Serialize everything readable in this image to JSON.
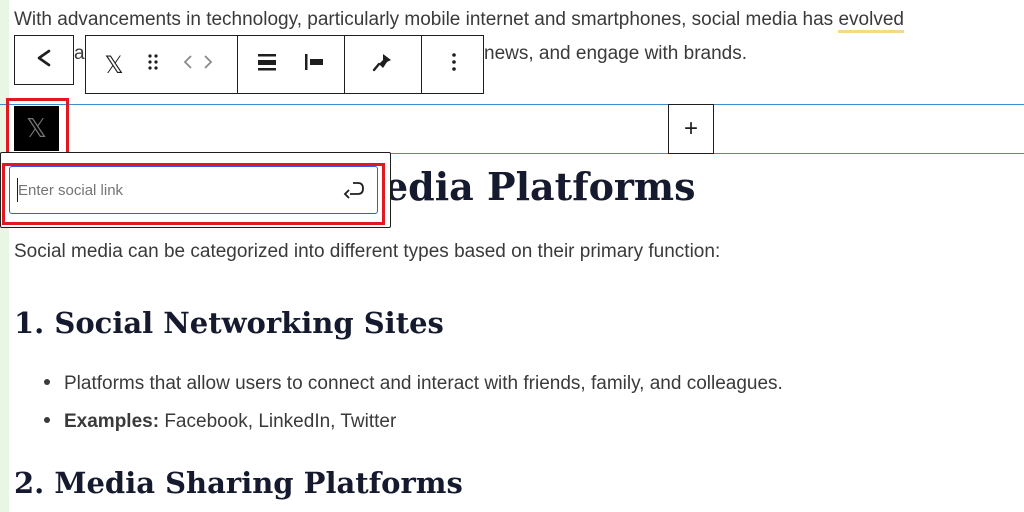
{
  "content": {
    "para1_line1_a": "With advancements in technology, particularly mobile internet and smartphones, social media has ",
    "para1_line1_hl": "evolved",
    "para1_line2_partial_a": "a",
    "para1_line2_partial_b": "news, and engage with brands.",
    "heading_types_partial": "edia Platforms",
    "intro": "Social media can be categorized into different types based on their primary function:",
    "h_social_networking": "1. Social Networking Sites",
    "bullet1": "Platforms that allow users to connect and interact with friends, family, and colleagues.",
    "bullet2_label": "Examples:",
    "bullet2_text": " Facebook, LinkedIn, Twitter",
    "h_media_sharing": "2. Media Sharing Platforms"
  },
  "toolbar": {
    "share_icon": "share-icon",
    "x_logo_icon": "x-logo-icon",
    "drag_icon": "drag-handle-icon",
    "move_icon": "move-arrows-icon",
    "align_icon": "justify-icon",
    "align_left_icon": "align-left-icon",
    "pin_icon": "pin-icon",
    "options_icon": "more-options-icon"
  },
  "social_link": {
    "x_glyph": "𝕏",
    "placeholder": "Enter social link",
    "value": ""
  },
  "inserter": {
    "label": "+"
  },
  "colors": {
    "accent": "#3858e9",
    "highlight_box": "#e0181f",
    "selection_line": "#3d8bd1"
  }
}
